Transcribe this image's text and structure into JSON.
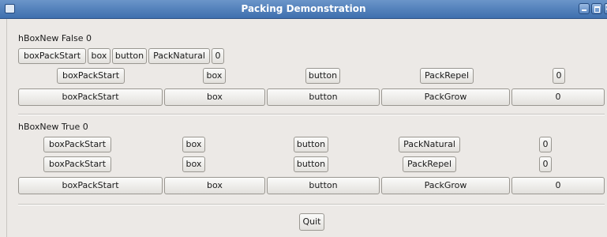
{
  "window": {
    "title": "Packing Demonstration"
  },
  "section1": {
    "label": "hBoxNew False 0",
    "row1": [
      "boxPackStart",
      "box",
      "button",
      "PackNatural",
      "0"
    ],
    "row2": [
      "boxPackStart",
      "box",
      "button",
      "PackRepel",
      "0"
    ],
    "row3": [
      "boxPackStart",
      "box",
      "button",
      "PackGrow",
      "0"
    ]
  },
  "section2": {
    "label": "hBoxNew True 0",
    "row1": [
      "boxPackStart",
      "box",
      "button",
      "PackNatural",
      "0"
    ],
    "row2": [
      "boxPackStart",
      "box",
      "button",
      "PackRepel",
      "0"
    ],
    "row3": [
      "boxPackStart",
      "box",
      "button",
      "PackGrow",
      "0"
    ]
  },
  "quit_label": "Quit"
}
